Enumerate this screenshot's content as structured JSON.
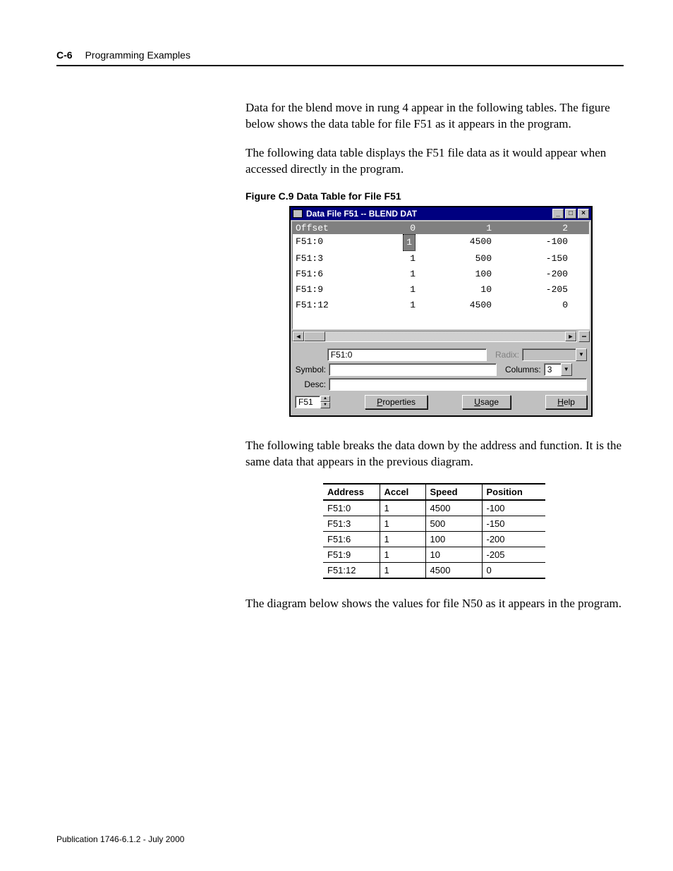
{
  "header": {
    "page_num": "C-6",
    "section": "Programming Examples"
  },
  "paragraphs": {
    "p1": "Data for the blend move in rung 4 appear in the following tables. The figure below shows the data table for file F51 as it appears in the program.",
    "p2": "The following data table displays the F51 file data as it would appear when accessed directly in the program.",
    "fig_caption": "Figure C.9 Data Table for File F51",
    "p3": "The following table breaks the data down by the address and function.  It is the same data that appears in the previous diagram.",
    "p4": "The diagram below shows the values for file N50 as it appears in the program."
  },
  "dialog": {
    "title": "Data File F51  --  BLEND DAT",
    "grid_head": {
      "offset": "Offset",
      "c0": "0",
      "c1": "1",
      "c2": "2"
    },
    "rows": [
      {
        "offset": "F51:0",
        "c0": "1",
        "c1": "4500",
        "c2": "-100"
      },
      {
        "offset": "F51:3",
        "c0": "1",
        "c1": "500",
        "c2": "-150"
      },
      {
        "offset": "F51:6",
        "c0": "1",
        "c1": "100",
        "c2": "-200"
      },
      {
        "offset": "F51:9",
        "c0": "1",
        "c1": "10",
        "c2": "-205"
      },
      {
        "offset": "F51:12",
        "c0": "1",
        "c1": "4500",
        "c2": "0"
      }
    ],
    "addr_input": "F51:0",
    "radix_label": "Radix:",
    "symbol_label": "Symbol:",
    "columns_label": "Columns:",
    "columns_value": "3",
    "desc_label": "Desc:",
    "file_spin": "F51",
    "btn_properties": "Properties",
    "btn_usage": "Usage",
    "btn_help": "Help"
  },
  "summary_table": {
    "head": {
      "address": "Address",
      "accel": "Accel",
      "speed": "Speed",
      "position": "Position"
    },
    "rows": [
      {
        "address": "F51:0",
        "accel": "1",
        "speed": "4500",
        "position": "-100"
      },
      {
        "address": "F51:3",
        "accel": "1",
        "speed": "500",
        "position": "-150"
      },
      {
        "address": "F51:6",
        "accel": "1",
        "speed": "100",
        "position": "-200"
      },
      {
        "address": "F51:9",
        "accel": "1",
        "speed": "10",
        "position": "-205"
      },
      {
        "address": "F51:12",
        "accel": "1",
        "speed": "4500",
        "position": "0"
      }
    ]
  },
  "footer": "Publication 1746-6.1.2 - July 2000",
  "chart_data": {
    "type": "table",
    "title": "Data Table for File F51 (BLEND DAT)",
    "columns": [
      "Address/Offset",
      "Accel (col 0)",
      "Speed (col 1)",
      "Position (col 2)"
    ],
    "rows": [
      [
        "F51:0",
        1,
        4500,
        -100
      ],
      [
        "F51:3",
        1,
        500,
        -150
      ],
      [
        "F51:6",
        1,
        100,
        -200
      ],
      [
        "F51:9",
        1,
        10,
        -205
      ],
      [
        "F51:12",
        1,
        4500,
        0
      ]
    ]
  }
}
